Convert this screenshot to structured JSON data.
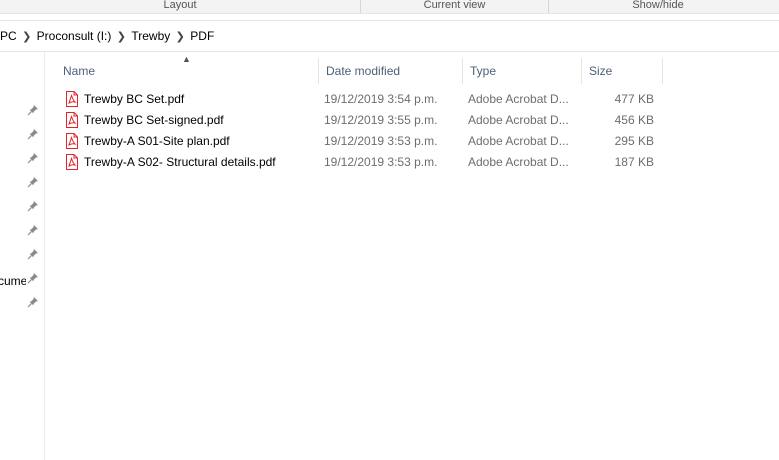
{
  "ribbon": {
    "groups": [
      "Layout",
      "Current view",
      "Show/hide"
    ]
  },
  "address": {
    "crumbs": [
      "PC",
      "Proconsult (I:)",
      "Trewby",
      "PDF"
    ]
  },
  "nav": {
    "pin_count": 9,
    "partial_label": "cume"
  },
  "columns": {
    "name": "Name",
    "date": "Date modified",
    "type": "Type",
    "size": "Size"
  },
  "files": [
    {
      "name": "Trewby BC Set.pdf",
      "date": "19/12/2019 3:54 p.m.",
      "type": "Adobe Acrobat D...",
      "size": "477 KB",
      "icon": "pdf-file-icon"
    },
    {
      "name": "Trewby BC Set-signed.pdf",
      "date": "19/12/2019 3:55 p.m.",
      "type": "Adobe Acrobat D...",
      "size": "456 KB",
      "icon": "pdf-file-icon"
    },
    {
      "name": "Trewby-A S01-Site plan.pdf",
      "date": "19/12/2019 3:53 p.m.",
      "type": "Adobe Acrobat D...",
      "size": "295 KB",
      "icon": "pdf-file-icon"
    },
    {
      "name": "Trewby-A S02- Structural details.pdf",
      "date": "19/12/2019 3:53 p.m.",
      "type": "Adobe Acrobat D...",
      "size": "187 KB",
      "icon": "pdf-file-icon"
    }
  ],
  "colors": {
    "header_text": "#4c607a",
    "pdf_red": "#e0242b",
    "secondary_text": "#6d6d6d"
  }
}
